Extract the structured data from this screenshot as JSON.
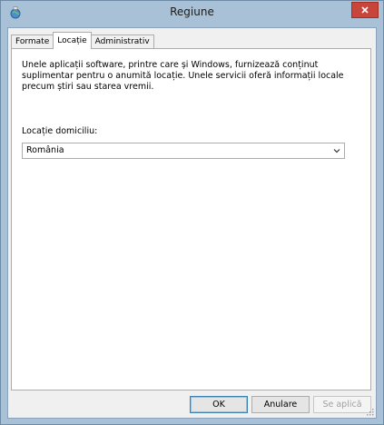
{
  "window": {
    "title": "Regiune",
    "close_icon": "close-icon",
    "app_icon": "region-globe-icon"
  },
  "tabs": [
    {
      "label": "Formate",
      "active": false
    },
    {
      "label": "Locație",
      "active": true
    },
    {
      "label": "Administrativ",
      "active": false
    }
  ],
  "location": {
    "description": "Unele aplicații software, printre care și Windows, furnizează conținut suplimentar pentru o anumită locație. Unele servicii oferă informații locale precum știri sau starea vremii.",
    "home_label": "Locație domiciliu:",
    "home_value": "România"
  },
  "buttons": {
    "ok": "OK",
    "cancel": "Anulare",
    "apply": "Se aplică"
  },
  "colors": {
    "frame": "#a9c1d6",
    "close": "#c7453a",
    "ok_border": "#3c7fb1"
  }
}
